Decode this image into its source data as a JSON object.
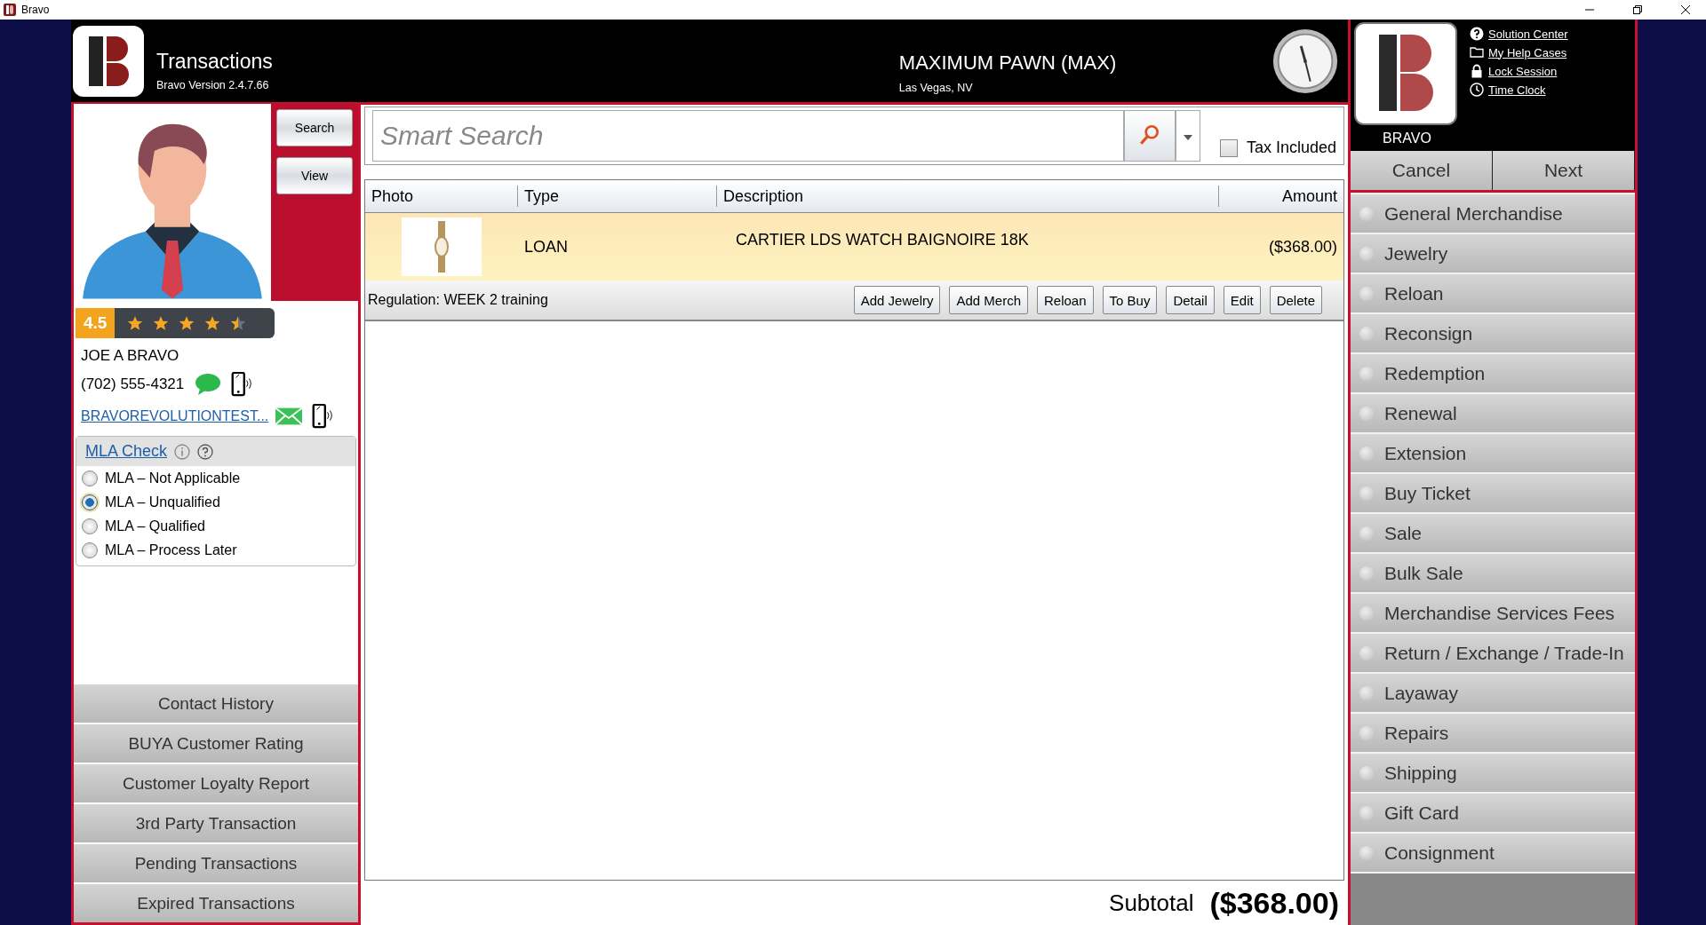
{
  "window": {
    "title": "Bravo"
  },
  "header": {
    "title": "Transactions",
    "version": "Bravo Version 2.4.7.66",
    "store_name": "MAXIMUM PAWN (MAX)",
    "store_location": "Las Vegas, NV",
    "user": "BRAVO"
  },
  "links": [
    {
      "kind": "help",
      "label": "Solution Center"
    },
    {
      "kind": "folder",
      "label": "My Help Cases"
    },
    {
      "kind": "lock",
      "label": "Lock Session"
    },
    {
      "kind": "clock",
      "label": "Time Clock"
    }
  ],
  "customer": {
    "buttons": [
      "Search",
      "View"
    ],
    "rating": "4.5",
    "stars": 4.5,
    "name": "JOE A BRAVO",
    "phone": "(702) 555-4321",
    "email": "BRAVOREVOLUTIONTEST...",
    "mla": {
      "title": "MLA Check",
      "options": [
        {
          "label": "MLA – Not Applicable",
          "selected": false
        },
        {
          "label": "MLA – Unqualified",
          "selected": true
        },
        {
          "label": "MLA – Qualified",
          "selected": false
        },
        {
          "label": "MLA – Process Later",
          "selected": false
        }
      ]
    }
  },
  "customer_actions": [
    "Contact History",
    "BUYA Customer Rating",
    "Customer Loyalty Report",
    "3rd Party Transaction",
    "Pending Transactions",
    "Expired Transactions"
  ],
  "search": {
    "placeholder": "Smart Search",
    "tax_included": {
      "label": "Tax Included",
      "checked": false
    }
  },
  "table": {
    "columns": [
      "Photo",
      "Type",
      "Description",
      "Amount"
    ],
    "rows": [
      {
        "type": "LOAN",
        "description": "CARTIER LDS WATCH BAIGNOIRE 18K",
        "amount": "($368.00)",
        "selected": true
      }
    ]
  },
  "regulation": "Regulation: WEEK 2 training",
  "row_actions": [
    "Add Jewelry",
    "Add Merch",
    "Reloan",
    "To Buy",
    "Detail",
    "Edit",
    "Delete"
  ],
  "subtotal": {
    "label": "Subtotal",
    "value": "($368.00)"
  },
  "actions": [
    "Cancel",
    "Next"
  ],
  "transaction_types": [
    {
      "label": "General Merchandise",
      "selected": false
    },
    {
      "label": "Jewelry",
      "selected": false
    },
    {
      "label": "Reloan",
      "selected": false
    },
    {
      "label": "Reconsign",
      "selected": false
    },
    {
      "label": "Redemption",
      "selected": false
    },
    {
      "label": "Renewal",
      "selected": false
    },
    {
      "label": "Extension",
      "selected": false
    },
    {
      "label": "Buy Ticket",
      "selected": false
    },
    {
      "label": "Sale",
      "selected": false
    },
    {
      "label": "Bulk Sale",
      "selected": false
    },
    {
      "label": "Merchandise Services Fees",
      "selected": false
    },
    {
      "label": "Return / Exchange / Trade-In",
      "selected": false
    },
    {
      "label": "Layaway",
      "selected": false
    },
    {
      "label": "Repairs",
      "selected": false
    },
    {
      "label": "Shipping",
      "selected": false
    },
    {
      "label": "Gift Card",
      "selected": false
    },
    {
      "label": "Consignment",
      "selected": false
    }
  ]
}
